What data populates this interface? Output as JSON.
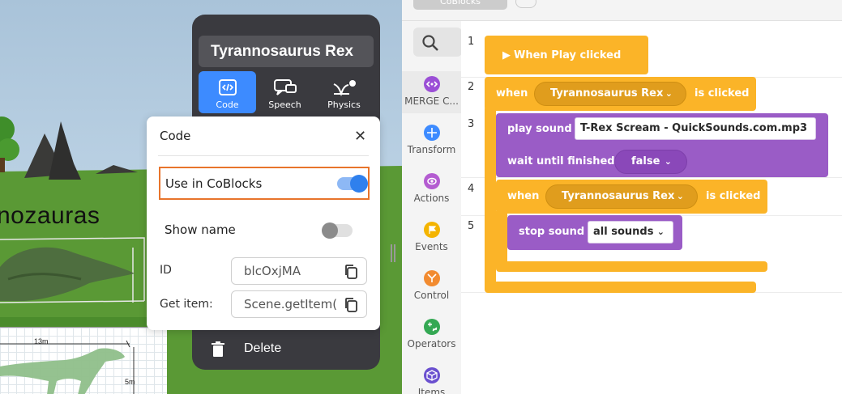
{
  "scene": {
    "title_fragment": "nozauras",
    "dim_width": "13m",
    "dim_height": "5m"
  },
  "object_panel": {
    "name": "Tyrannosaurus Rex",
    "tabs": [
      {
        "label": "Code",
        "icon": "code-icon",
        "active": true
      },
      {
        "label": "Speech",
        "icon": "speech-icon",
        "active": false
      },
      {
        "label": "Physics",
        "icon": "physics-icon",
        "active": false
      }
    ],
    "delete_label": "Delete"
  },
  "code_popup": {
    "title": "Code",
    "use_in_coblocks_label": "Use in CoBlocks",
    "use_in_coblocks_enabled": true,
    "show_name_label": "Show name",
    "show_name_enabled": false,
    "id_label": "ID",
    "id_value": "blcOxjMA",
    "get_item_label": "Get item:",
    "get_item_value": "Scene.getItem("
  },
  "editor": {
    "tab_label": "CoBlocks",
    "palette": [
      {
        "label": "MERGE C...",
        "icon": "merge-cube-icon",
        "color": "#9b4fd6",
        "active": true
      },
      {
        "label": "Transform",
        "icon": "transform-icon",
        "color": "#3d8bff",
        "active": false
      },
      {
        "label": "Actions",
        "icon": "actions-icon",
        "color": "#b45cd1",
        "active": false
      },
      {
        "label": "Events",
        "icon": "events-icon",
        "color": "#f4b400",
        "active": false
      },
      {
        "label": "Control",
        "icon": "control-icon",
        "color": "#f28b30",
        "active": false
      },
      {
        "label": "Operators",
        "icon": "operators-icon",
        "color": "#34a853",
        "active": false
      },
      {
        "label": "Items",
        "icon": "items-icon",
        "color": "#6a4fcf",
        "active": false
      }
    ],
    "line_numbers": [
      "1",
      "2",
      "3",
      "4",
      "5"
    ],
    "blocks": {
      "when_play": "When Play clicked",
      "when1": "when",
      "object1": "Tyrannosaurus Rex",
      "is_clicked1": "is clicked",
      "play_sound": "play sound",
      "sound_file": "T-Rex Scream - QuickSounds.com.mp3",
      "wait_until": "wait until finished",
      "wait_value": "false",
      "when2": "when",
      "object2": "Tyrannosaurus Rex",
      "is_clicked2": "is clicked",
      "stop_sound": "stop sound",
      "stop_target": "all sounds"
    },
    "colors": {
      "event": "#fbb428",
      "sound": "#9a5cc6",
      "accent": "#3d8bff",
      "highlight": "#e8742b"
    }
  }
}
